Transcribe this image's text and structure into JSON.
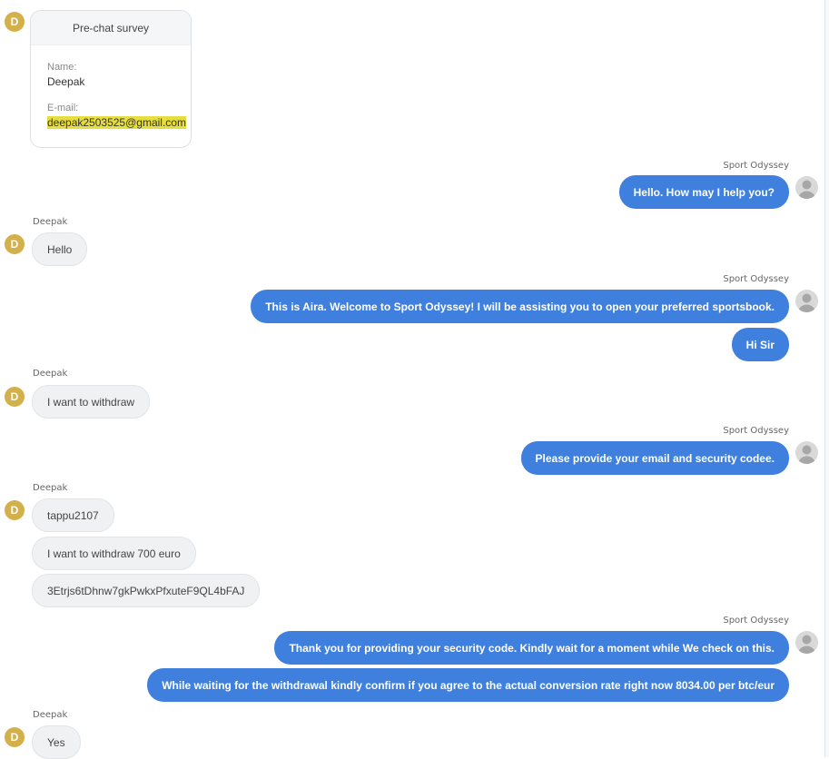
{
  "survey": {
    "title": "Pre-chat survey",
    "name_label": "Name:",
    "name_value": "Deepak",
    "email_label": "E-mail:",
    "email_value": "deepak2503525@gmail.com"
  },
  "visitor": {
    "initial": "D",
    "name": "Deepak"
  },
  "agent": {
    "name": "Sport Odyssey"
  },
  "messages": {
    "m1": "Hello. How may I help you?",
    "m2": "Hello",
    "m3": "This is Aira. Welcome to Sport Odyssey! I will be assisting you to open your preferred sportsbook.",
    "m4": "Hi Sir",
    "m5": "I want to withdraw",
    "m6": "Please provide your email and security codee.",
    "m7": "tappu2107",
    "m8": "I want to withdraw 700 euro",
    "m9": "3Etrjs6tDhnw7gkPwkxPfxuteF9QL4bFAJ",
    "m10": "Thank you for providing your security code. Kindly wait for a moment while We check on this.",
    "m11": "While waiting for the withdrawal kindly confirm if you agree to the actual conversion rate right now 8034.00 per btc/eur",
    "m12": "Yes"
  },
  "colors": {
    "agent_bubble": "#3f80de",
    "visitor_bubble": "#f0f1f3",
    "visitor_avatar": "#d3b04a",
    "email_highlight": "#e6dd3f"
  }
}
